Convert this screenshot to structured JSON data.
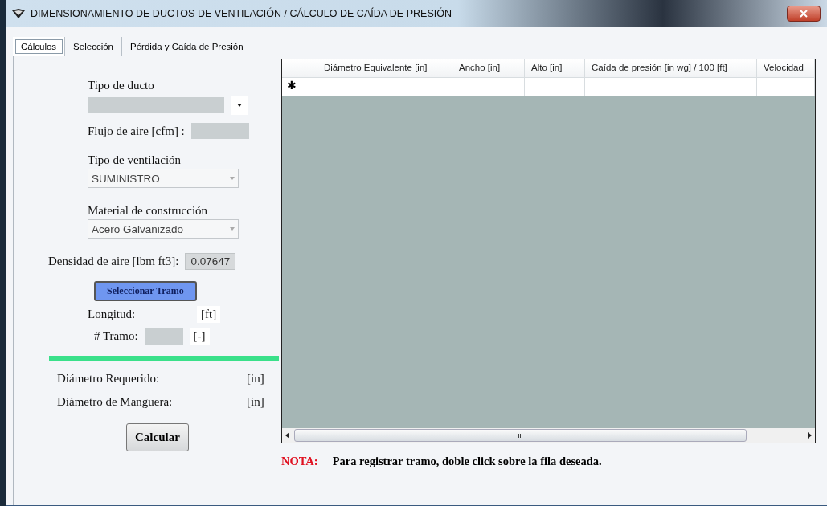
{
  "window": {
    "title": "DIMENSIONAMIENTO DE DUCTOS  DE VENTILACIÓN / CÁLCULO DE CAÍDA DE PRESIÓN"
  },
  "tabs": [
    {
      "label": "Cálculos",
      "selected": true
    },
    {
      "label": "Selección",
      "selected": false
    },
    {
      "label": "Pérdida y Caída de Presión",
      "selected": false
    }
  ],
  "form": {
    "duct_type_label": "Tipo de ducto",
    "airflow_label": "Flujo de aire [cfm] :",
    "ventilation_label": "Tipo de ventilación",
    "ventilation_value": "SUMINISTRO",
    "material_label": "Material de construcción",
    "material_value": "Acero Galvanizado",
    "density_label": "Densidad de aire [lbm ft3]:",
    "density_value": "0.07647",
    "select_button": "Seleccionar Tramo",
    "length_label": "Longitud:",
    "length_unit": "[ft]",
    "segment_label": "# Tramo:",
    "segment_unit": "[-]",
    "required_label": "Diámetro Requerido:",
    "required_unit": "[in]",
    "hose_label": "Diámetro de Manguera:",
    "hose_unit": "[in]",
    "calc_button": "Calcular"
  },
  "table": {
    "columns": [
      "Diámetro Equivalente [in]",
      "Ancho [in]",
      "Alto [in]",
      "Caída de presión [in wg] / 100 [ft]",
      "Velocidad"
    ],
    "new_row_marker": "✱",
    "scroll_grip": "III"
  },
  "note": {
    "label": "NOTA:",
    "text": "Para registrar tramo, doble click sobre la fila deseada."
  }
}
